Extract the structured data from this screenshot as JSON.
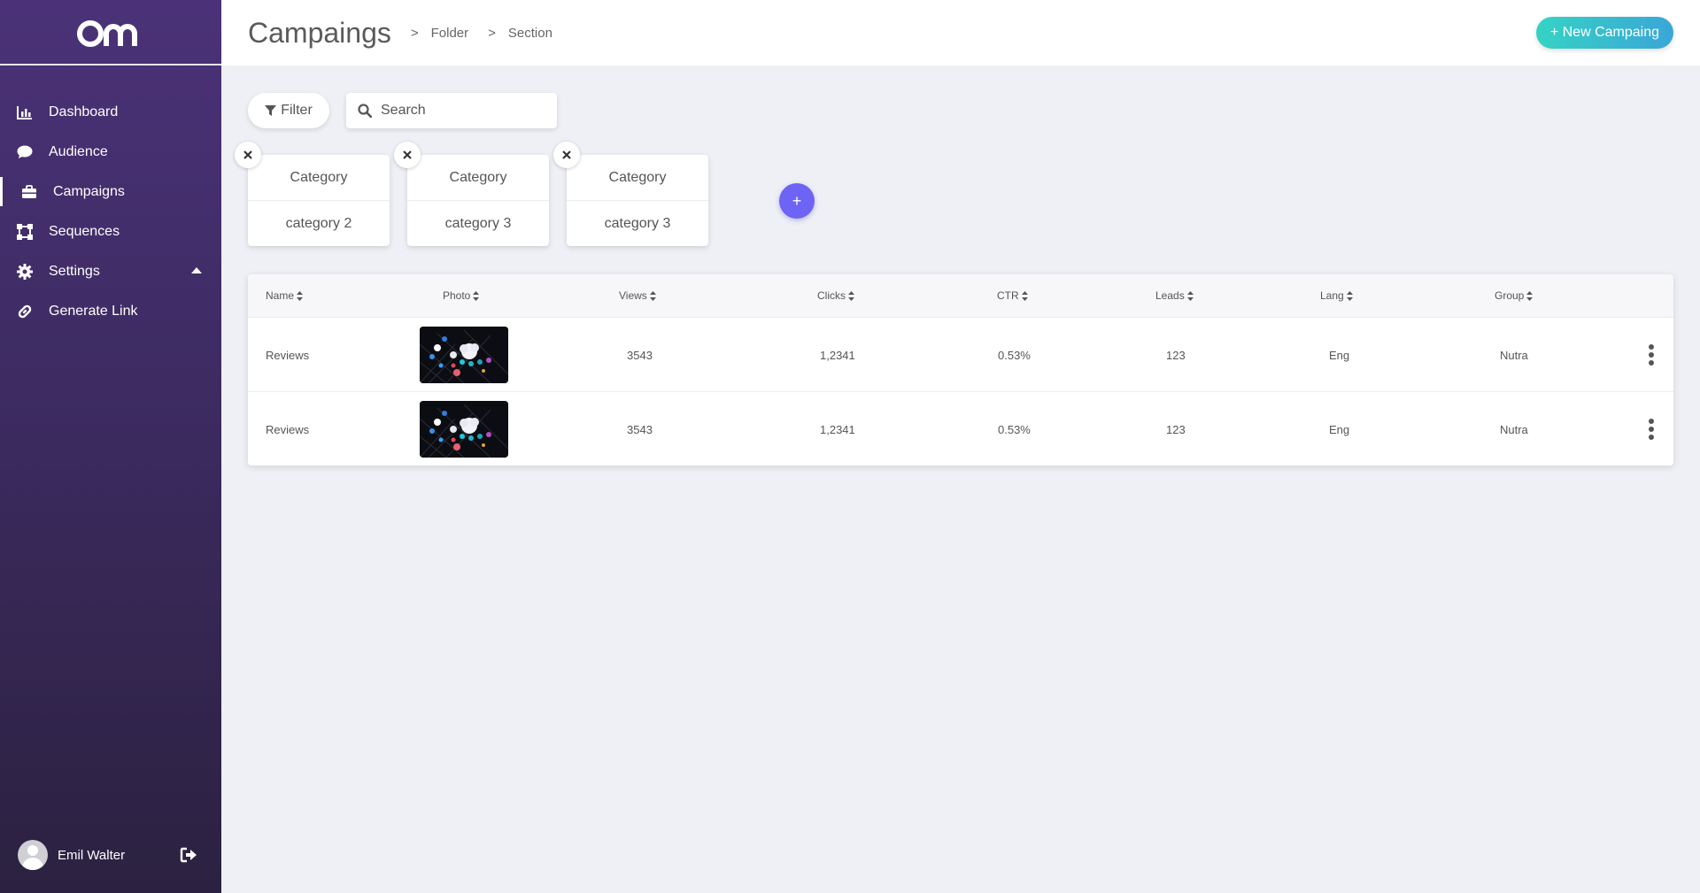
{
  "sidebar": {
    "logo_text": "om",
    "items": [
      {
        "label": "Dashboard",
        "icon": "bar-chart-icon"
      },
      {
        "label": "Audience",
        "icon": "chat-bubble-icon"
      },
      {
        "label": "Campaigns",
        "icon": "briefcase-icon",
        "active": true
      },
      {
        "label": "Sequences",
        "icon": "vector-square-icon"
      },
      {
        "label": "Settings",
        "icon": "gear-icon",
        "expanded": true
      },
      {
        "label": "Generate Link",
        "icon": "link-icon"
      }
    ],
    "user": {
      "name": "Emil Walter"
    }
  },
  "header": {
    "title": "Campaings",
    "breadcrumb": [
      "Folder",
      "Section"
    ],
    "separator": ">",
    "new_button": "+ New Campaing"
  },
  "toolbar": {
    "filter_label": "Filter",
    "search_placeholder": "Search"
  },
  "categories": [
    {
      "title": "Category",
      "value": "category 2"
    },
    {
      "title": "Category",
      "value": "category 3"
    },
    {
      "title": "Category",
      "value": "category 3"
    }
  ],
  "add_category_label": "+",
  "table": {
    "columns": [
      "Name",
      "Photo",
      "Views",
      "Clicks",
      "CTR",
      "Leads",
      "Lang",
      "Group"
    ],
    "rows": [
      {
        "name": "Reviews",
        "views": "3543",
        "clicks": "1,2341",
        "ctr": "0.53%",
        "leads": "123",
        "lang": "Eng",
        "group": "Nutra"
      },
      {
        "name": "Reviews",
        "views": "3543",
        "clicks": "1,2341",
        "ctr": "0.53%",
        "leads": "123",
        "lang": "Eng",
        "group": "Nutra"
      }
    ]
  },
  "colors": {
    "sidebar_top": "#4b3278",
    "sidebar_bottom": "#2b2140",
    "accent_button": "#35d3c4",
    "add_button": "#6d63f4",
    "background": "#eef0f5"
  }
}
